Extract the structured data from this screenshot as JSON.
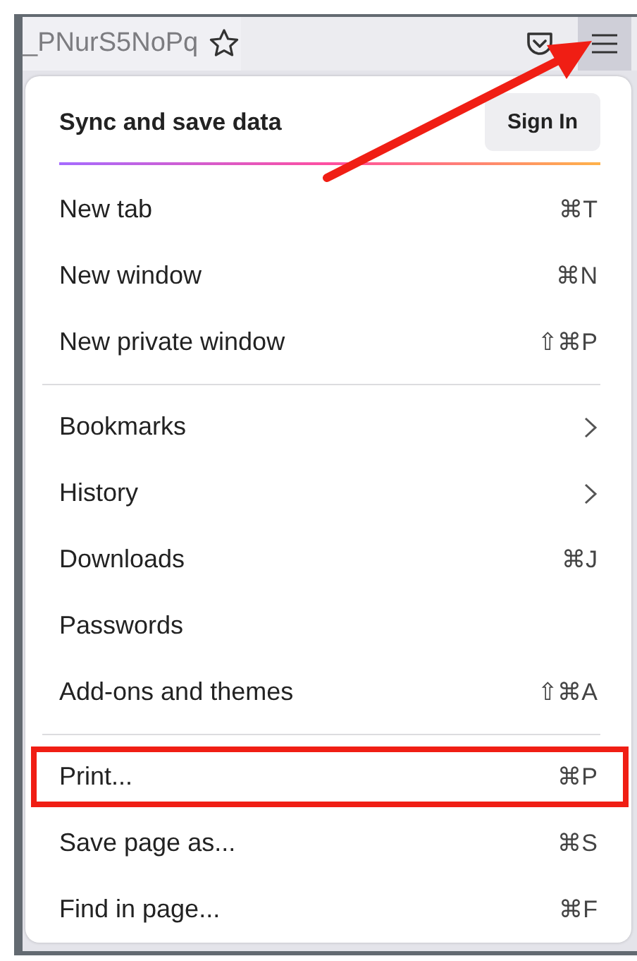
{
  "toolbar": {
    "url_fragment": "_PNurS5NoPq",
    "menu_button": {
      "selected": true
    }
  },
  "menu": {
    "header": {
      "title": "Sync and save data",
      "button": "Sign In"
    },
    "sections": [
      [
        {
          "kind": "shortcut",
          "label": "New tab",
          "shortcut": "⌘T",
          "highlighted": false
        },
        {
          "kind": "shortcut",
          "label": "New window",
          "shortcut": "⌘N",
          "highlighted": false
        },
        {
          "kind": "shortcut",
          "label": "New private window",
          "shortcut": "⇧⌘P",
          "highlighted": false
        }
      ],
      [
        {
          "kind": "submenu",
          "label": "Bookmarks",
          "highlighted": false
        },
        {
          "kind": "submenu",
          "label": "History",
          "highlighted": false
        },
        {
          "kind": "shortcut",
          "label": "Downloads",
          "shortcut": "⌘J",
          "highlighted": false
        },
        {
          "kind": "plain",
          "label": "Passwords",
          "highlighted": false
        },
        {
          "kind": "shortcut",
          "label": "Add-ons and themes",
          "shortcut": "⇧⌘A",
          "highlighted": false
        }
      ],
      [
        {
          "kind": "shortcut",
          "label": "Print...",
          "shortcut": "⌘P",
          "highlighted": true
        },
        {
          "kind": "shortcut",
          "label": "Save page as...",
          "shortcut": "⌘S",
          "highlighted": false
        },
        {
          "kind": "shortcut",
          "label": "Find in page...",
          "shortcut": "⌘F",
          "highlighted": false
        }
      ]
    ]
  },
  "annotation": {
    "kind": "arrow"
  }
}
